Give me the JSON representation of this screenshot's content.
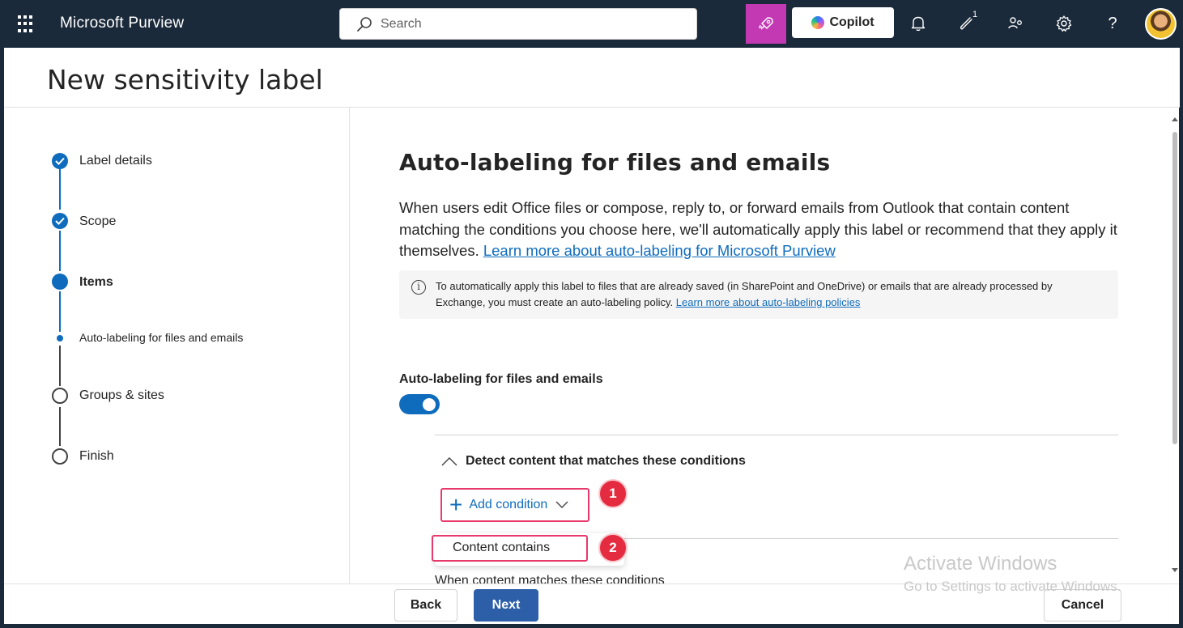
{
  "app": {
    "name": "Microsoft Purview"
  },
  "search": {
    "placeholder": "Search"
  },
  "topbar": {
    "copilot_label": "Copilot",
    "notification_count": "1",
    "accent_color": "#c239b3"
  },
  "page": {
    "title": "New sensitivity label"
  },
  "steps": [
    {
      "label": "Label details",
      "state": "done"
    },
    {
      "label": "Scope",
      "state": "done"
    },
    {
      "label": "Items",
      "state": "current"
    },
    {
      "label": "Auto-labeling for files and emails",
      "state": "current-sub"
    },
    {
      "label": "Groups & sites",
      "state": "pending"
    },
    {
      "label": "Finish",
      "state": "pending"
    }
  ],
  "main": {
    "heading": "Auto-labeling for files and emails",
    "description": "When users edit Office files or compose, reply to, or forward emails from Outlook that contain content matching the conditions you choose here, we'll automatically apply this label or recommend that they apply it themselves.",
    "description_link": "Learn more about auto-labeling for Microsoft Purview",
    "info_text": "To automatically apply this label to files that are already saved (in SharePoint and OneDrive) or emails that are already processed by Exchange, you must create an auto-labeling policy.",
    "info_link": "Learn more about auto-labeling policies",
    "toggle_label": "Auto-labeling for files and emails",
    "toggle_on": true,
    "section_title": "Detect content that matches these conditions",
    "add_condition_label": "Add condition",
    "menu_item_content_contains": "Content contains",
    "when_match_text": "When content matches these conditions",
    "callout_1": "1",
    "callout_2": "2"
  },
  "watermark": {
    "line1": "Activate Windows",
    "line2": "Go to Settings to activate Windows."
  },
  "footer": {
    "back_label": "Back",
    "next_label": "Next",
    "cancel_label": "Cancel"
  },
  "colors": {
    "topbar_bg": "#1b2a3a",
    "primary": "#0f6cbd",
    "highlight": "#e8396b",
    "callout": "#e52b3f"
  }
}
